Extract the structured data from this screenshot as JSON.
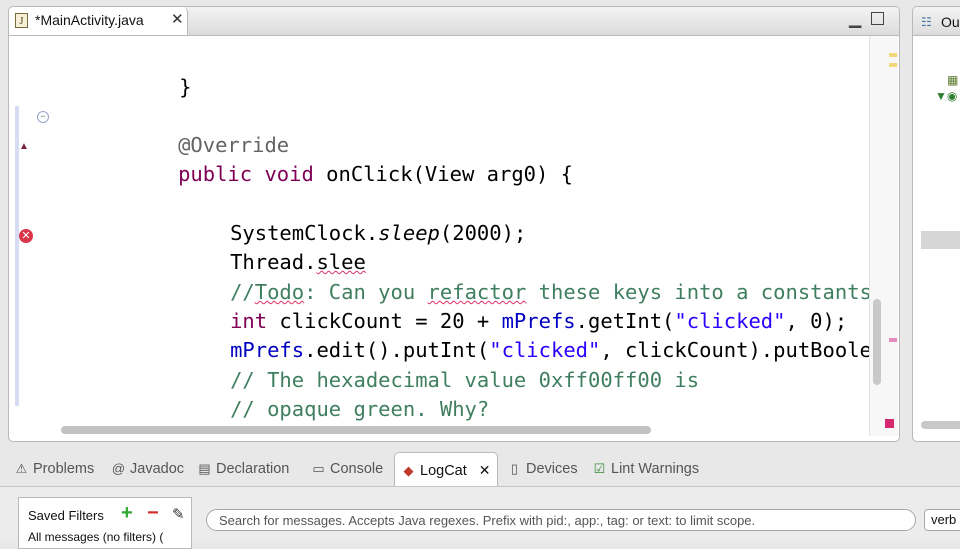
{
  "editor": {
    "tab_title": "*MainActivity.java",
    "tab_icon": "J",
    "close_glyph": "✕",
    "minimize_glyph": "▁",
    "fold_glyph": "−",
    "override_glyph": "▲",
    "error_glyph": "✕",
    "code": {
      "brace_close": "}",
      "annotation": "@Override",
      "kw_public": "public",
      "kw_void": "void",
      "method_sig": " onClick(View arg0) {",
      "sleep_prefix": "SystemClock.",
      "sleep_method": "sleep",
      "sleep_suffix": "(2000);",
      "thread_prefix": "Thread.",
      "thread_partial": "slee",
      "comment1_prefix": "//",
      "comment1_todo": "Todo",
      "comment1_mid": ": Can you ",
      "comment1_refactor": "refactor",
      "comment1_end": " these keys into a constants?",
      "kw_int": "int",
      "line_int_a": " clickCount = 20 + ",
      "field_prefs": "mPrefs",
      "line_int_b": ".getInt(",
      "str_clicked": "\"clicked\"",
      "line_int_c": ", 0);",
      "line_edit_a": ".edit().putInt(",
      "line_edit_b": ", clickCount).putBoolean(\"",
      "comment2": "// The hexadecimal value 0xff00ff00 is",
      "comment3": "// opaque green. Why?"
    }
  },
  "outline": {
    "tab_label": "Ou",
    "icon": "☷",
    "grid_icon": "▦",
    "class_icon": "▼◉"
  },
  "bottom_tabs": [
    {
      "label": "Problems",
      "icon": "⚠"
    },
    {
      "label": "Javadoc",
      "icon": "@"
    },
    {
      "label": "Declaration",
      "icon": "▤"
    },
    {
      "label": "Console",
      "icon": "▭"
    },
    {
      "label": "LogCat",
      "icon": "◆",
      "close": "✕"
    },
    {
      "label": "Devices",
      "icon": "▯"
    },
    {
      "label": "Lint Warnings",
      "icon": "☑"
    }
  ],
  "logcat": {
    "saved_filters_label": "Saved Filters",
    "add_glyph": "+",
    "remove_glyph": "−",
    "edit_glyph": "✎",
    "all_messages": "All messages (no filters) (",
    "search_placeholder": "Search for messages. Accepts Java regexes. Prefix with pid:, app:, tag: or text: to limit scope.",
    "log_level": "verb"
  },
  "colors": {
    "keyword": "#7f0055",
    "comment": "#3f7f5f",
    "field": "#0000c0",
    "string": "#2a00ff",
    "error": "#d9364a"
  }
}
